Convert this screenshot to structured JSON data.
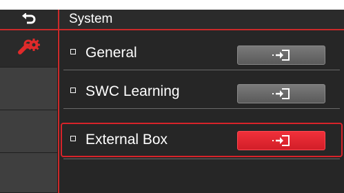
{
  "header": {
    "title": "System",
    "back_icon": "back-arrow-icon"
  },
  "sidebar": {
    "items": [
      {
        "icon": "wrench-gear-icon",
        "active": true
      },
      {
        "active": false
      },
      {
        "active": false
      },
      {
        "active": false
      }
    ]
  },
  "menu": {
    "items": [
      {
        "label": "General",
        "selected": false,
        "action_icon": "enter-icon"
      },
      {
        "label": "SWC Learning",
        "selected": false,
        "action_icon": "enter-icon"
      },
      {
        "label": "External Box",
        "selected": true,
        "action_icon": "enter-icon"
      }
    ]
  },
  "colors": {
    "accent": "#d8232a",
    "background": "#262626",
    "sidebar": "#3a3a3a",
    "button": "#6a6a6a"
  }
}
